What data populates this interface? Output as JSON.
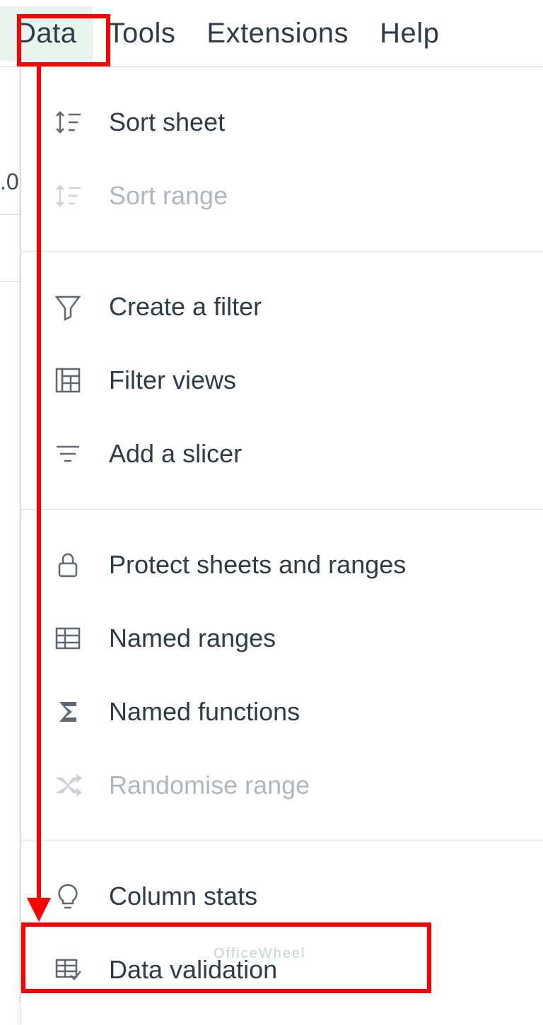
{
  "menubar": {
    "items": [
      {
        "label": "Data",
        "active": true
      },
      {
        "label": "Tools",
        "active": false
      },
      {
        "label": "Extensions",
        "active": false
      },
      {
        "label": "Help",
        "active": false
      }
    ]
  },
  "leftstrip": {
    "stub_text": ".0"
  },
  "dropdown": {
    "sections": [
      [
        {
          "label": "Sort sheet",
          "icon": "sort-sheet-icon",
          "disabled": false
        },
        {
          "label": "Sort range",
          "icon": "sort-range-icon",
          "disabled": true
        }
      ],
      [
        {
          "label": "Create a filter",
          "icon": "filter-icon",
          "disabled": false
        },
        {
          "label": "Filter views",
          "icon": "filter-views-icon",
          "disabled": false
        },
        {
          "label": "Add a slicer",
          "icon": "slicer-icon",
          "disabled": false
        }
      ],
      [
        {
          "label": "Protect sheets and ranges",
          "icon": "lock-icon",
          "disabled": false
        },
        {
          "label": "Named ranges",
          "icon": "named-ranges-icon",
          "disabled": false
        },
        {
          "label": "Named functions",
          "icon": "sigma-icon",
          "disabled": false
        },
        {
          "label": "Randomise range",
          "icon": "shuffle-icon",
          "disabled": true
        }
      ],
      [
        {
          "label": "Column stats",
          "icon": "bulb-icon",
          "disabled": false
        },
        {
          "label": "Data validation",
          "icon": "data-validation-icon",
          "disabled": false
        }
      ]
    ]
  },
  "highlights": {
    "menu_highlighted": "Data",
    "item_highlighted": "Data validation",
    "color": "#ff0000"
  },
  "watermark": "OfficeWheel"
}
